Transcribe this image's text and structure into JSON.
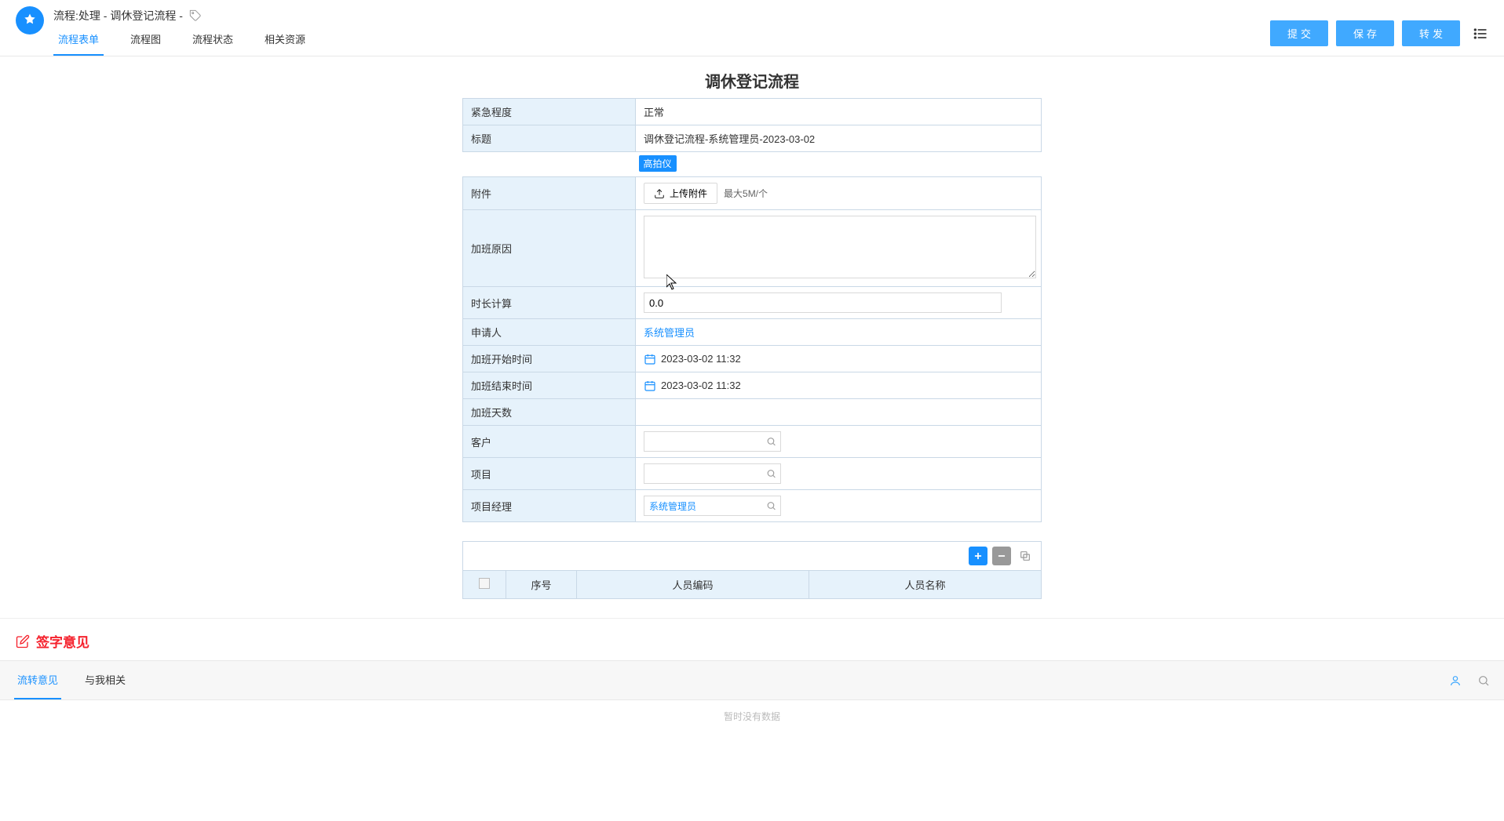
{
  "header": {
    "page_title_prefix": "流程:处理 - ",
    "page_title_main": "调休登记流程 - ",
    "tabs": [
      "流程表单",
      "流程图",
      "流程状态",
      "相关资源"
    ],
    "active_tab_index": 0,
    "buttons": {
      "submit": "提交",
      "save": "保存",
      "forward": "转发"
    }
  },
  "form": {
    "title": "调休登记流程",
    "rows": {
      "urgency": {
        "label": "紧急程度",
        "value": "正常"
      },
      "subject": {
        "label": "标题",
        "value": "调休登记流程-系统管理员-2023-03-02"
      },
      "gaopaiyi": "高拍仪",
      "attachment": {
        "label": "附件",
        "upload_btn": "上传附件",
        "max_size": "最大5M/个"
      },
      "reason": {
        "label": "加班原因",
        "value": ""
      },
      "duration": {
        "label": "时长计算",
        "value": "0.0"
      },
      "applicant": {
        "label": "申请人",
        "value": "系统管理员"
      },
      "start_time": {
        "label": "加班开始时间",
        "value": "2023-03-02 11:32"
      },
      "end_time": {
        "label": "加班结束时间",
        "value": "2023-03-02 11:32"
      },
      "days": {
        "label": "加班天数",
        "value": ""
      },
      "customer": {
        "label": "客户",
        "value": ""
      },
      "project": {
        "label": "项目",
        "value": ""
      },
      "pm": {
        "label": "项目经理",
        "value": "系统管理员"
      }
    }
  },
  "detail": {
    "columns": {
      "seq": "序号",
      "person_code": "人员编码",
      "person_name": "人员名称"
    }
  },
  "sign": {
    "title": "签字意见",
    "tabs": [
      "流转意见",
      "与我相关"
    ],
    "active_tab_index": 0,
    "empty": "暂时没有数据"
  }
}
